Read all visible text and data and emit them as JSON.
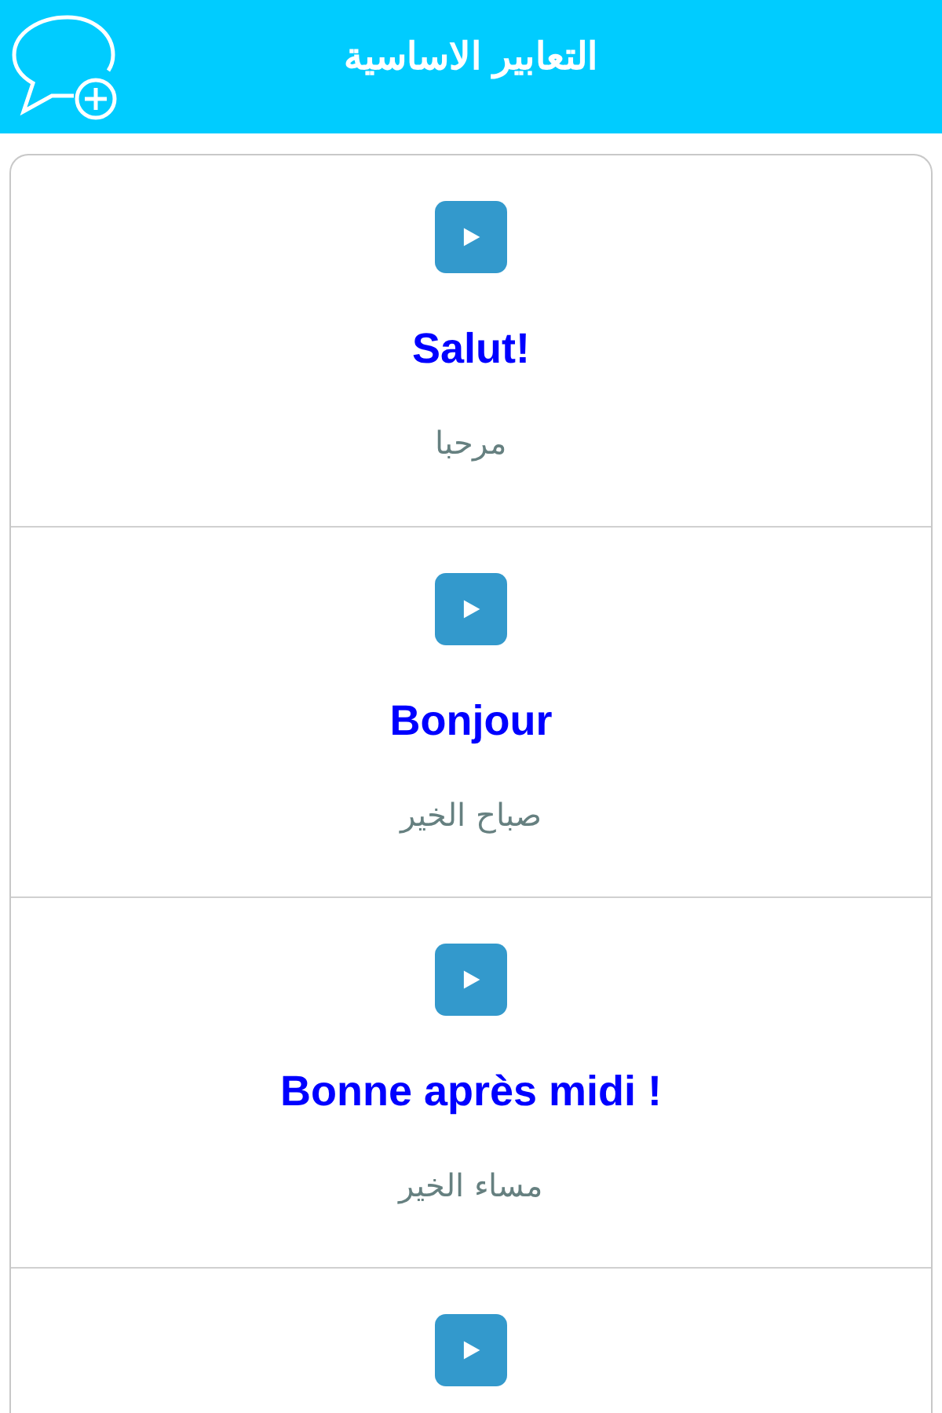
{
  "header": {
    "title": "التعابير الاساسية"
  },
  "phrases": [
    {
      "kind": "phrase",
      "french": "Salut!",
      "arabic": "مرحبا"
    },
    {
      "kind": "phrase",
      "french": "Bonjour",
      "arabic": "صباح الخير"
    },
    {
      "kind": "phrase",
      "french": "Bonne après midi !",
      "arabic": "مساء الخير"
    },
    {
      "kind": "clipped"
    }
  ]
}
